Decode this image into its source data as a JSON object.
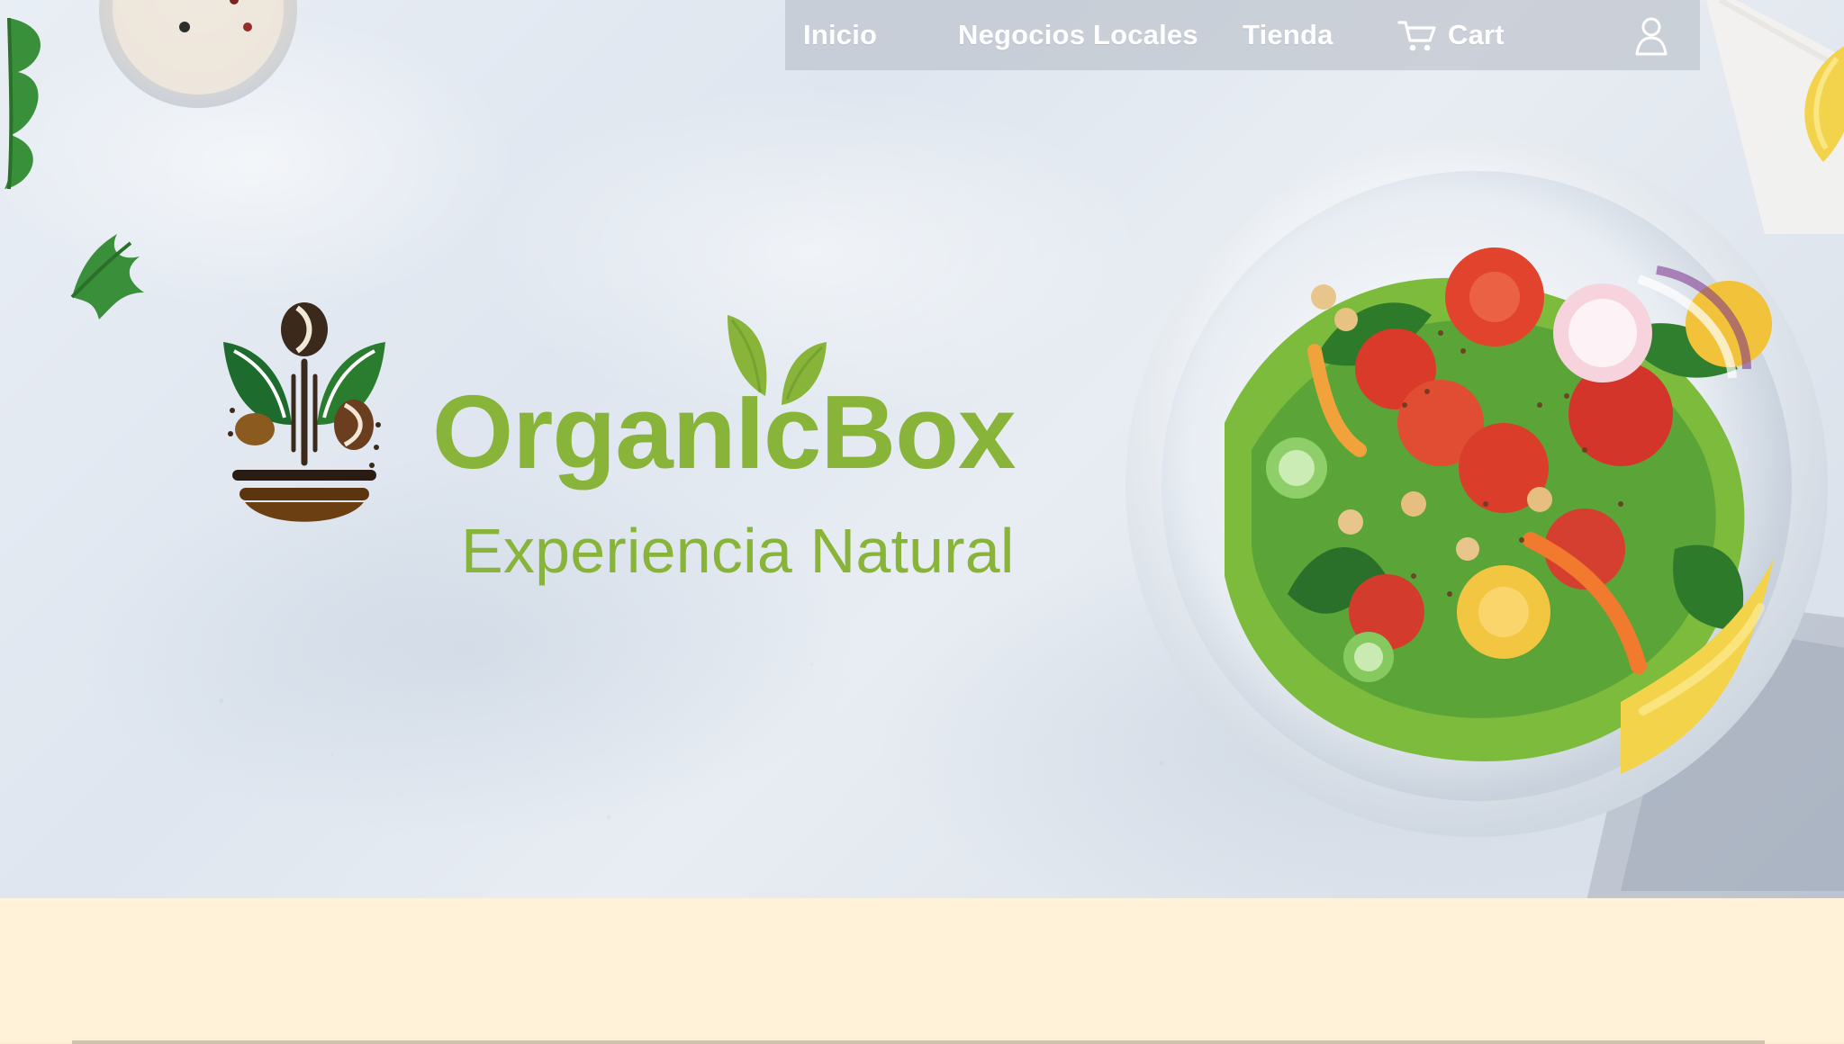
{
  "nav": {
    "items": [
      {
        "label": "Inicio"
      },
      {
        "label": "Negocios Locales"
      },
      {
        "label": "Tienda"
      }
    ],
    "cart_label": "Cart"
  },
  "hero": {
    "brand_name": "OrganIcBox",
    "tagline": "Experiencia Natural"
  },
  "colors": {
    "brand_green": "#88b43a",
    "nav_bg": "rgba(180,186,194,0.55)",
    "page_bg": "#fff2d9"
  },
  "icons": {
    "cart": "shopping-cart-icon",
    "profile": "user-profile-icon",
    "logo": "organic-box-logo-icon",
    "sprout": "sprout-leaves-icon"
  }
}
